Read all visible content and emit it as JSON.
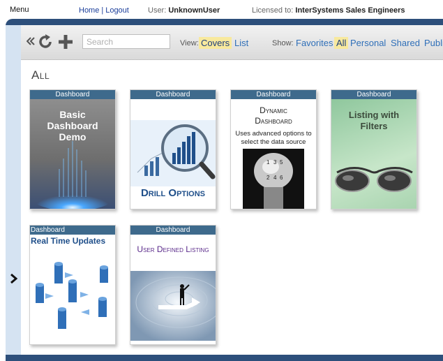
{
  "topbar": {
    "menu": "Menu",
    "home": "Home",
    "separator": "|",
    "logout": "Logout",
    "user_label": "User:",
    "user_name": "UnknownUser",
    "licensed_label": "Licensed to:",
    "licensed_to": "InterSystems Sales Engineers"
  },
  "toolbar": {
    "search_placeholder": "Search",
    "view_label": "View:",
    "view_options": [
      "Covers",
      "List"
    ],
    "view_active": "Covers",
    "show_label": "Show:",
    "show_options": [
      "Favorites",
      "All",
      "Personal",
      "Shared",
      "Publi"
    ],
    "show_active": "All"
  },
  "section_title": "All",
  "cards": [
    {
      "type": "Dashboard",
      "title": "Basic Dashboard Demo"
    },
    {
      "type": "Dashboard",
      "title": "Drill Options"
    },
    {
      "type": "Dashboard",
      "title": "Dynamic Dashboard",
      "subtitle": "Uses advanced options to select the data source"
    },
    {
      "type": "Dashboard",
      "title": "Listing with Filters"
    },
    {
      "type": "Dashboard",
      "title": "Real Time Updates"
    },
    {
      "type": "Dashboard",
      "title": "User Defined Listing"
    }
  ],
  "colors": {
    "frame": "#2d4f7b",
    "sidebar": "#d5e3f2",
    "card_header": "#3e6a8c",
    "link": "#2f6fb8",
    "highlight": "#f8e99d"
  }
}
